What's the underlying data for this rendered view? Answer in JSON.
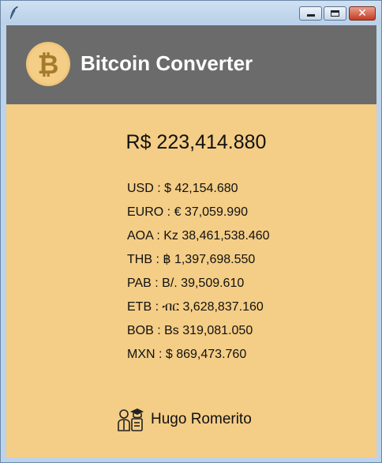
{
  "window": {
    "title": "",
    "controls": [
      "minimize",
      "maximize",
      "close"
    ],
    "close_glyph": "✕"
  },
  "header": {
    "title": "Bitcoin Converter",
    "logo_icon": "bitcoin-icon",
    "background": "#6b6b6b"
  },
  "main": {
    "background": "#f4cd86",
    "value": "R$ 223,414.880",
    "rates": [
      {
        "label": "USD : $ 42,154.680"
      },
      {
        "label": "EURO : € 37,059.990"
      },
      {
        "label": "AOA : Kz 38,461,538.460"
      },
      {
        "label": "THB : ฿ 1,397,698.550"
      },
      {
        "label": "PAB : B/. 39,509.610"
      },
      {
        "label": "ETB : ብር 3,628,837.160"
      },
      {
        "label": "BOB : Bs 319,081.050"
      },
      {
        "label": "MXN : $ 869,473.760"
      }
    ]
  },
  "footer": {
    "author": "Hugo Romerito",
    "author_icon": "users-graduation-icon"
  }
}
